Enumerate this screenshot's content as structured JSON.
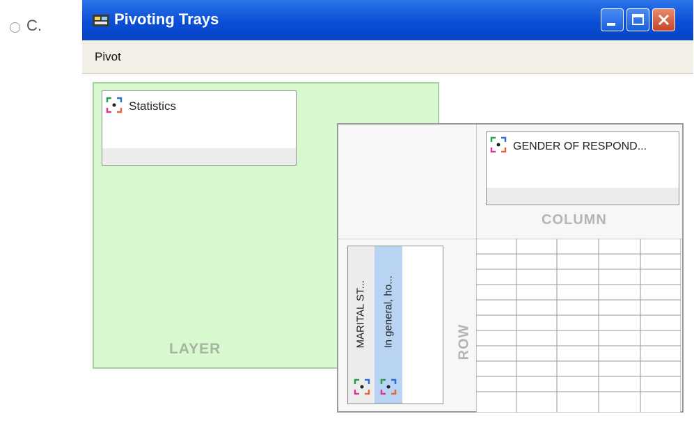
{
  "option": {
    "letter": "C."
  },
  "window": {
    "title": "Pivoting Trays",
    "menu": {
      "pivot": "Pivot"
    }
  },
  "layer_tray": {
    "label": "LAYER",
    "items": [
      {
        "label": "Statistics"
      }
    ]
  },
  "column_tray": {
    "label": "COLUMN",
    "items": [
      {
        "label": "GENDER OF RESPOND..."
      }
    ]
  },
  "row_tray": {
    "label": "ROW",
    "items": [
      {
        "label": "MARITAL ST..."
      },
      {
        "label": "In general, ho..."
      }
    ]
  },
  "colors": {
    "titlebar": "#0a4ed6",
    "layer_tray": "#d8f8d0",
    "row_selection": "#b8d4f2"
  },
  "icons": [
    "radio-button-icon",
    "window-app-icon",
    "minimize-icon",
    "maximize-icon",
    "close-icon",
    "field-icon"
  ]
}
